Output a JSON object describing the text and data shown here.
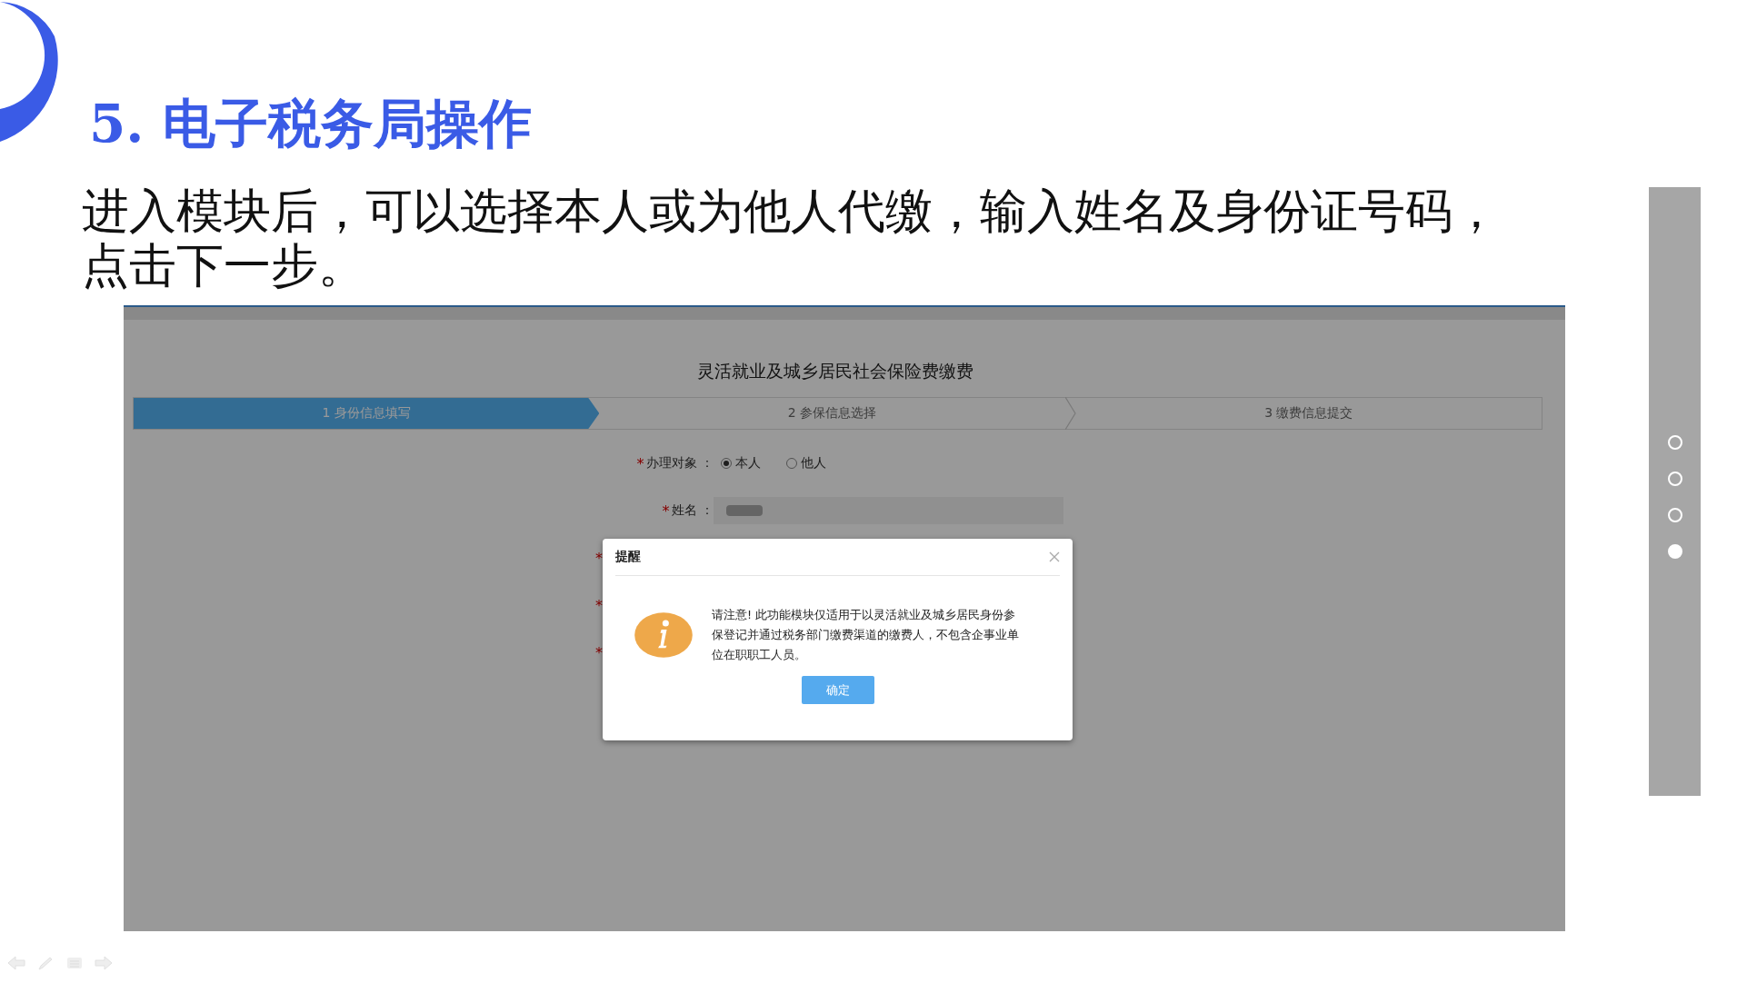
{
  "slide": {
    "title": "5. 电子税务局操作",
    "body": "进入模块后，可以选择本人或为他人代缴，输入姓名及身份证号码，点击下一步。"
  },
  "screenshot": {
    "page_title": "灵活就业及城乡居民社会保险费缴费",
    "steps": [
      {
        "label": "1 身份信息填写",
        "selected": true
      },
      {
        "label": "2 参保信息选择",
        "selected": false
      },
      {
        "label": "3 缴费信息提交",
        "selected": false
      }
    ],
    "form": {
      "rows": [
        {
          "kind": "radio",
          "mark": "*",
          "label": "办理对象 ：",
          "options": [
            {
              "label": "本人",
              "selected": true
            },
            {
              "label": "他人",
              "selected": false
            }
          ]
        },
        {
          "kind": "input",
          "mark": "*",
          "label": "姓名 ："
        },
        {
          "kind": "hidden",
          "mark": "*"
        },
        {
          "kind": "hidden",
          "mark": "*"
        },
        {
          "kind": "hidden",
          "mark": "*"
        }
      ]
    },
    "dialog": {
      "title": "提醒",
      "message": "请注意! 此功能模块仅适用于以灵活就业及城乡居民身份参保登记并通过税务部门缴费渠道的缴费人，不包含企事业单位在职职工人员。",
      "button": "确定"
    }
  },
  "slide_nav": {
    "dots": [
      {
        "selected": false
      },
      {
        "selected": false
      },
      {
        "selected": false
      },
      {
        "selected": true
      }
    ]
  }
}
